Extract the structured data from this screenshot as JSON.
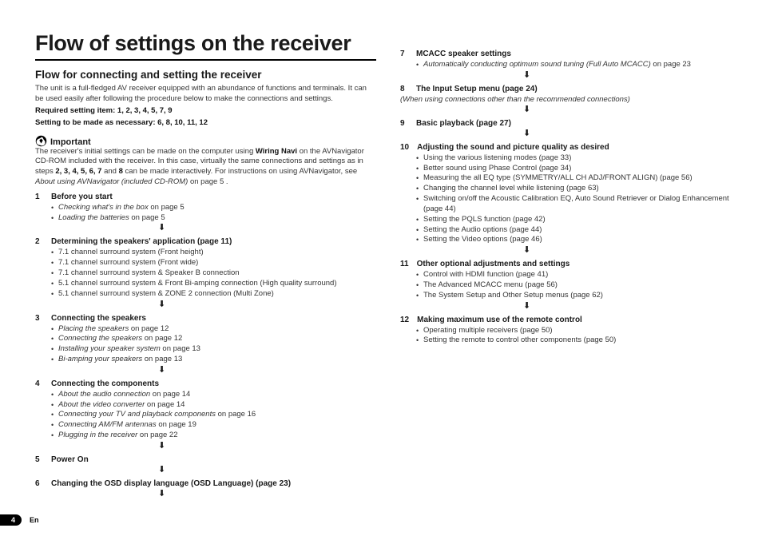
{
  "title": "Flow of settings on the receiver",
  "subtitle": "Flow for connecting and setting the receiver",
  "intro": "The unit is a full-fledged AV receiver equipped with an abundance of functions and terminals. It can be used easily after following the procedure below to make the connections and settings.",
  "required_label": "Required setting item",
  "required_vals": ": 1, 2, 3, 4, 5, 7, 9",
  "optional_label": "Setting to be made as necessary",
  "optional_vals": ": 6, 8, 10, 11, 12",
  "important": {
    "label": "Important",
    "text_a": "The receiver's initial settings can be made on the computer using ",
    "wiring": "Wiring Navi",
    "text_b": " on the AVNavigator CD-ROM included with the receiver. In this case, virtually the same connections and settings as in steps ",
    "steps_bold": "2, 3, 4, 5, 6, 7",
    "text_c": " and ",
    "step8": "8",
    "text_d": " can be made interactively. For instructions on using AVNavigator, see ",
    "ref_italic": "About using AVNavigator (included CD-ROM)",
    "ref_tail": " on page 5 ."
  },
  "left_steps": [
    {
      "num": "1",
      "title": "Before you start",
      "items": [
        {
          "i": "Checking what's in the box",
          "t": " on page 5"
        },
        {
          "i": "Loading the batteries",
          "t": " on page 5"
        }
      ],
      "arrow": true
    },
    {
      "num": "2",
      "title": "Determining the speakers' application (page 11)",
      "items": [
        {
          "t": "7.1 channel surround system (Front height)"
        },
        {
          "t": "7.1 channel surround system (Front wide)"
        },
        {
          "t": "7.1 channel surround system & Speaker B connection"
        },
        {
          "t": "5.1 channel surround system & Front Bi-amping connection (High quality surround)"
        },
        {
          "t": "5.1 channel surround system & ZONE 2 connection (Multi Zone)"
        }
      ],
      "arrow": true
    },
    {
      "num": "3",
      "title": "Connecting the speakers",
      "items": [
        {
          "i": "Placing the speakers",
          "t": " on page 12"
        },
        {
          "i": "Connecting the speakers",
          "t": " on page 12"
        },
        {
          "i": "Installing your speaker system",
          "t": " on page 13"
        },
        {
          "i": "Bi-amping your speakers",
          "t": " on page 13"
        }
      ],
      "arrow": true
    },
    {
      "num": "4",
      "title": "Connecting the components",
      "items": [
        {
          "i": "About the audio connection",
          "t": " on page 14"
        },
        {
          "i": "About the video converter",
          "t": " on page 14"
        },
        {
          "i": "Connecting your TV and playback components",
          "t": " on page 16"
        },
        {
          "i": "Connecting AM/FM antennas",
          "t": " on page 19"
        },
        {
          "i": "Plugging in the receiver",
          "t": " on page 22"
        }
      ],
      "arrow": true
    },
    {
      "num": "5",
      "title": "Power On",
      "items": [],
      "arrow": true
    },
    {
      "num": "6",
      "title": "Changing the OSD display language (OSD Language) (page 23)",
      "items": [],
      "arrow": true
    }
  ],
  "right_steps": [
    {
      "num": "7",
      "title": "MCACC speaker settings",
      "items": [
        {
          "i": "Automatically conducting optimum sound tuning (Full Auto MCACC)",
          "t": " on page 23"
        }
      ],
      "arrow": true
    },
    {
      "num": "8",
      "title": "The Input Setup menu (page 24)",
      "note": "(When using connections other than the recommended connections)",
      "items": [],
      "arrow": true
    },
    {
      "num": "9",
      "title": "Basic playback (page 27)",
      "items": [],
      "arrow": true
    },
    {
      "num": "10",
      "title": "Adjusting the sound and picture quality as desired",
      "items": [
        {
          "t": "Using the various listening modes (page 33)"
        },
        {
          "t": "Better sound using Phase Control (page 34)"
        },
        {
          "t": "Measuring the all EQ type (SYMMETRY/ALL CH ADJ/FRONT ALIGN) (page 56)"
        },
        {
          "t": "Changing the channel level while listening (page 63)"
        },
        {
          "t": "Switching on/off the Acoustic Calibration EQ, Auto Sound Retriever or Dialog Enhancement (page 44)"
        },
        {
          "t": "Setting the PQLS function (page 42)"
        },
        {
          "t": "Setting the Audio options (page 44)"
        },
        {
          "t": "Setting the Video options (page 46)"
        }
      ],
      "arrow": true
    },
    {
      "num": "11",
      "title": "Other optional adjustments and settings",
      "items": [
        {
          "t": "Control with HDMI function (page 41)"
        },
        {
          "t": "The Advanced MCACC menu (page 56)"
        },
        {
          "t": "The System Setup and Other Setup menus (page 62)"
        }
      ],
      "arrow": true
    },
    {
      "num": "12",
      "title": "Making maximum use of the remote control",
      "items": [
        {
          "t": "Operating multiple receivers (page 50)"
        },
        {
          "t": "Setting the remote to control other components (page 50)"
        }
      ],
      "arrow": false
    }
  ],
  "footer": {
    "page": "4",
    "lang": "En"
  }
}
